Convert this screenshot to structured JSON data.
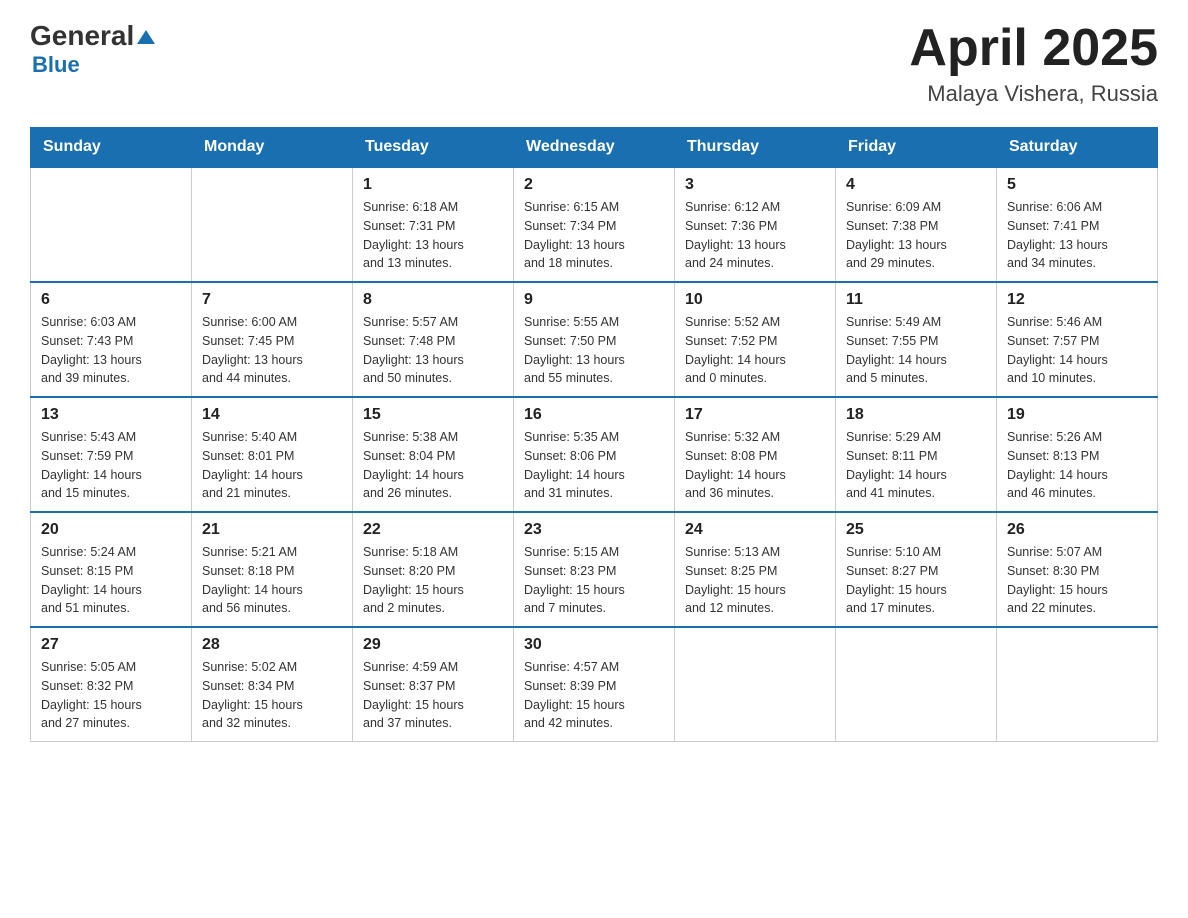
{
  "header": {
    "logo": {
      "general": "General",
      "arrow": "▲",
      "blue": "Blue"
    },
    "title": "April 2025",
    "location": "Malaya Vishera, Russia"
  },
  "days_of_week": [
    "Sunday",
    "Monday",
    "Tuesday",
    "Wednesday",
    "Thursday",
    "Friday",
    "Saturday"
  ],
  "weeks": [
    [
      {
        "day": "",
        "info": ""
      },
      {
        "day": "",
        "info": ""
      },
      {
        "day": "1",
        "info": "Sunrise: 6:18 AM\nSunset: 7:31 PM\nDaylight: 13 hours\nand 13 minutes."
      },
      {
        "day": "2",
        "info": "Sunrise: 6:15 AM\nSunset: 7:34 PM\nDaylight: 13 hours\nand 18 minutes."
      },
      {
        "day": "3",
        "info": "Sunrise: 6:12 AM\nSunset: 7:36 PM\nDaylight: 13 hours\nand 24 minutes."
      },
      {
        "day": "4",
        "info": "Sunrise: 6:09 AM\nSunset: 7:38 PM\nDaylight: 13 hours\nand 29 minutes."
      },
      {
        "day": "5",
        "info": "Sunrise: 6:06 AM\nSunset: 7:41 PM\nDaylight: 13 hours\nand 34 minutes."
      }
    ],
    [
      {
        "day": "6",
        "info": "Sunrise: 6:03 AM\nSunset: 7:43 PM\nDaylight: 13 hours\nand 39 minutes."
      },
      {
        "day": "7",
        "info": "Sunrise: 6:00 AM\nSunset: 7:45 PM\nDaylight: 13 hours\nand 44 minutes."
      },
      {
        "day": "8",
        "info": "Sunrise: 5:57 AM\nSunset: 7:48 PM\nDaylight: 13 hours\nand 50 minutes."
      },
      {
        "day": "9",
        "info": "Sunrise: 5:55 AM\nSunset: 7:50 PM\nDaylight: 13 hours\nand 55 minutes."
      },
      {
        "day": "10",
        "info": "Sunrise: 5:52 AM\nSunset: 7:52 PM\nDaylight: 14 hours\nand 0 minutes."
      },
      {
        "day": "11",
        "info": "Sunrise: 5:49 AM\nSunset: 7:55 PM\nDaylight: 14 hours\nand 5 minutes."
      },
      {
        "day": "12",
        "info": "Sunrise: 5:46 AM\nSunset: 7:57 PM\nDaylight: 14 hours\nand 10 minutes."
      }
    ],
    [
      {
        "day": "13",
        "info": "Sunrise: 5:43 AM\nSunset: 7:59 PM\nDaylight: 14 hours\nand 15 minutes."
      },
      {
        "day": "14",
        "info": "Sunrise: 5:40 AM\nSunset: 8:01 PM\nDaylight: 14 hours\nand 21 minutes."
      },
      {
        "day": "15",
        "info": "Sunrise: 5:38 AM\nSunset: 8:04 PM\nDaylight: 14 hours\nand 26 minutes."
      },
      {
        "day": "16",
        "info": "Sunrise: 5:35 AM\nSunset: 8:06 PM\nDaylight: 14 hours\nand 31 minutes."
      },
      {
        "day": "17",
        "info": "Sunrise: 5:32 AM\nSunset: 8:08 PM\nDaylight: 14 hours\nand 36 minutes."
      },
      {
        "day": "18",
        "info": "Sunrise: 5:29 AM\nSunset: 8:11 PM\nDaylight: 14 hours\nand 41 minutes."
      },
      {
        "day": "19",
        "info": "Sunrise: 5:26 AM\nSunset: 8:13 PM\nDaylight: 14 hours\nand 46 minutes."
      }
    ],
    [
      {
        "day": "20",
        "info": "Sunrise: 5:24 AM\nSunset: 8:15 PM\nDaylight: 14 hours\nand 51 minutes."
      },
      {
        "day": "21",
        "info": "Sunrise: 5:21 AM\nSunset: 8:18 PM\nDaylight: 14 hours\nand 56 minutes."
      },
      {
        "day": "22",
        "info": "Sunrise: 5:18 AM\nSunset: 8:20 PM\nDaylight: 15 hours\nand 2 minutes."
      },
      {
        "day": "23",
        "info": "Sunrise: 5:15 AM\nSunset: 8:23 PM\nDaylight: 15 hours\nand 7 minutes."
      },
      {
        "day": "24",
        "info": "Sunrise: 5:13 AM\nSunset: 8:25 PM\nDaylight: 15 hours\nand 12 minutes."
      },
      {
        "day": "25",
        "info": "Sunrise: 5:10 AM\nSunset: 8:27 PM\nDaylight: 15 hours\nand 17 minutes."
      },
      {
        "day": "26",
        "info": "Sunrise: 5:07 AM\nSunset: 8:30 PM\nDaylight: 15 hours\nand 22 minutes."
      }
    ],
    [
      {
        "day": "27",
        "info": "Sunrise: 5:05 AM\nSunset: 8:32 PM\nDaylight: 15 hours\nand 27 minutes."
      },
      {
        "day": "28",
        "info": "Sunrise: 5:02 AM\nSunset: 8:34 PM\nDaylight: 15 hours\nand 32 minutes."
      },
      {
        "day": "29",
        "info": "Sunrise: 4:59 AM\nSunset: 8:37 PM\nDaylight: 15 hours\nand 37 minutes."
      },
      {
        "day": "30",
        "info": "Sunrise: 4:57 AM\nSunset: 8:39 PM\nDaylight: 15 hours\nand 42 minutes."
      },
      {
        "day": "",
        "info": ""
      },
      {
        "day": "",
        "info": ""
      },
      {
        "day": "",
        "info": ""
      }
    ]
  ]
}
